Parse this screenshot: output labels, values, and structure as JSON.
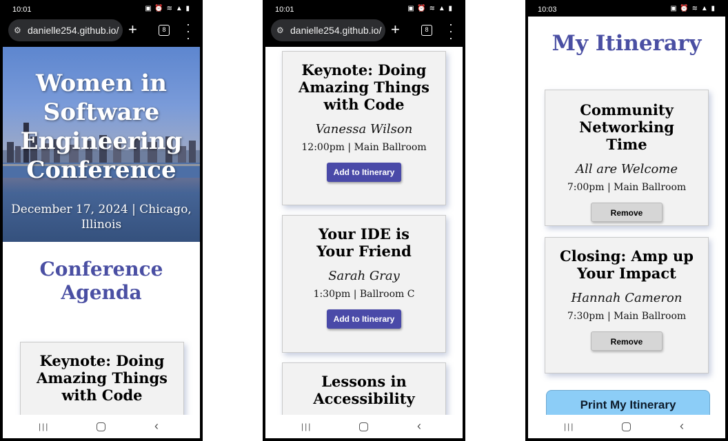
{
  "phone1": {
    "status": {
      "time": "10:01",
      "icons": "◎"
    },
    "browser": {
      "url": "danielle254.github.io/",
      "tab_count": "8"
    },
    "hero": {
      "title": "Women in Software Engineering Conference",
      "subtitle": "December 17, 2024 | Chicago, Illinois"
    },
    "agenda_title": "Conference Agenda",
    "card": {
      "title": "Keynote: Doing Amazing Things with Code"
    }
  },
  "phone2": {
    "status": {
      "time": "10:01"
    },
    "browser": {
      "url": "danielle254.github.io/",
      "tab_count": "8"
    },
    "sessions": [
      {
        "title": "Keynote: Doing Amazing Things with Code",
        "speaker": "Vanessa Wilson",
        "when": "12:00pm | Main Ballroom",
        "button": "Add to Itinerary"
      },
      {
        "title": "Your IDE is Your Friend",
        "speaker": "Sarah Gray",
        "when": "1:30pm | Ballroom C",
        "button": "Add to Itinerary"
      },
      {
        "title": "Lessons in Accessibility"
      }
    ]
  },
  "phone3": {
    "status": {
      "time": "10:03"
    },
    "itinerary_title": "My Itinerary",
    "items": [
      {
        "title": "Community Networking Time",
        "speaker": "All are Welcome",
        "when": "7:00pm | Main Ballroom",
        "button": "Remove"
      },
      {
        "title": "Closing: Amp up Your Impact",
        "speaker": "Hannah Cameron",
        "when": "7:30pm | Main Ballroom",
        "button": "Remove"
      }
    ],
    "print_button": "Print My Itinerary"
  },
  "colors": {
    "accent_purple": "#4a4fa3",
    "add_button": "#4a4aa8",
    "print_button": "#8ccdf7",
    "card_bg": "#f2f2f2"
  },
  "icons": [
    "site-settings-icon",
    "plus-icon",
    "tab-switcher-icon",
    "more-menu-icon",
    "recents-icon",
    "home-icon",
    "back-icon"
  ]
}
